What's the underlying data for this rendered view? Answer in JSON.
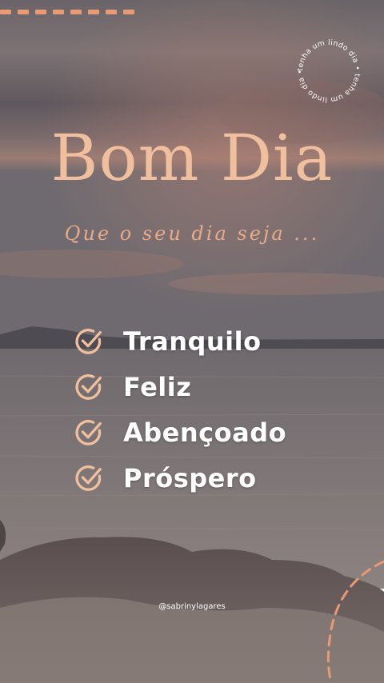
{
  "title": "Bom Dia",
  "subtitle": "Que o seu dia seja ...",
  "badge_text": "tenha um lindo dia • tenha um lindo dia •",
  "list": [
    {
      "label": "Tranquilo",
      "icon": "check-circle-icon"
    },
    {
      "label": "Feliz",
      "icon": "check-circle-icon"
    },
    {
      "label": "Abençoado",
      "icon": "check-circle-icon"
    },
    {
      "label": "Próspero",
      "icon": "check-circle-icon"
    }
  ],
  "handle": "@sabrinylagares",
  "colors": {
    "accent": "#f0c09e",
    "subtitle": "#e9aa86",
    "dash": "#e79a73",
    "list_text": "#ffffff"
  }
}
